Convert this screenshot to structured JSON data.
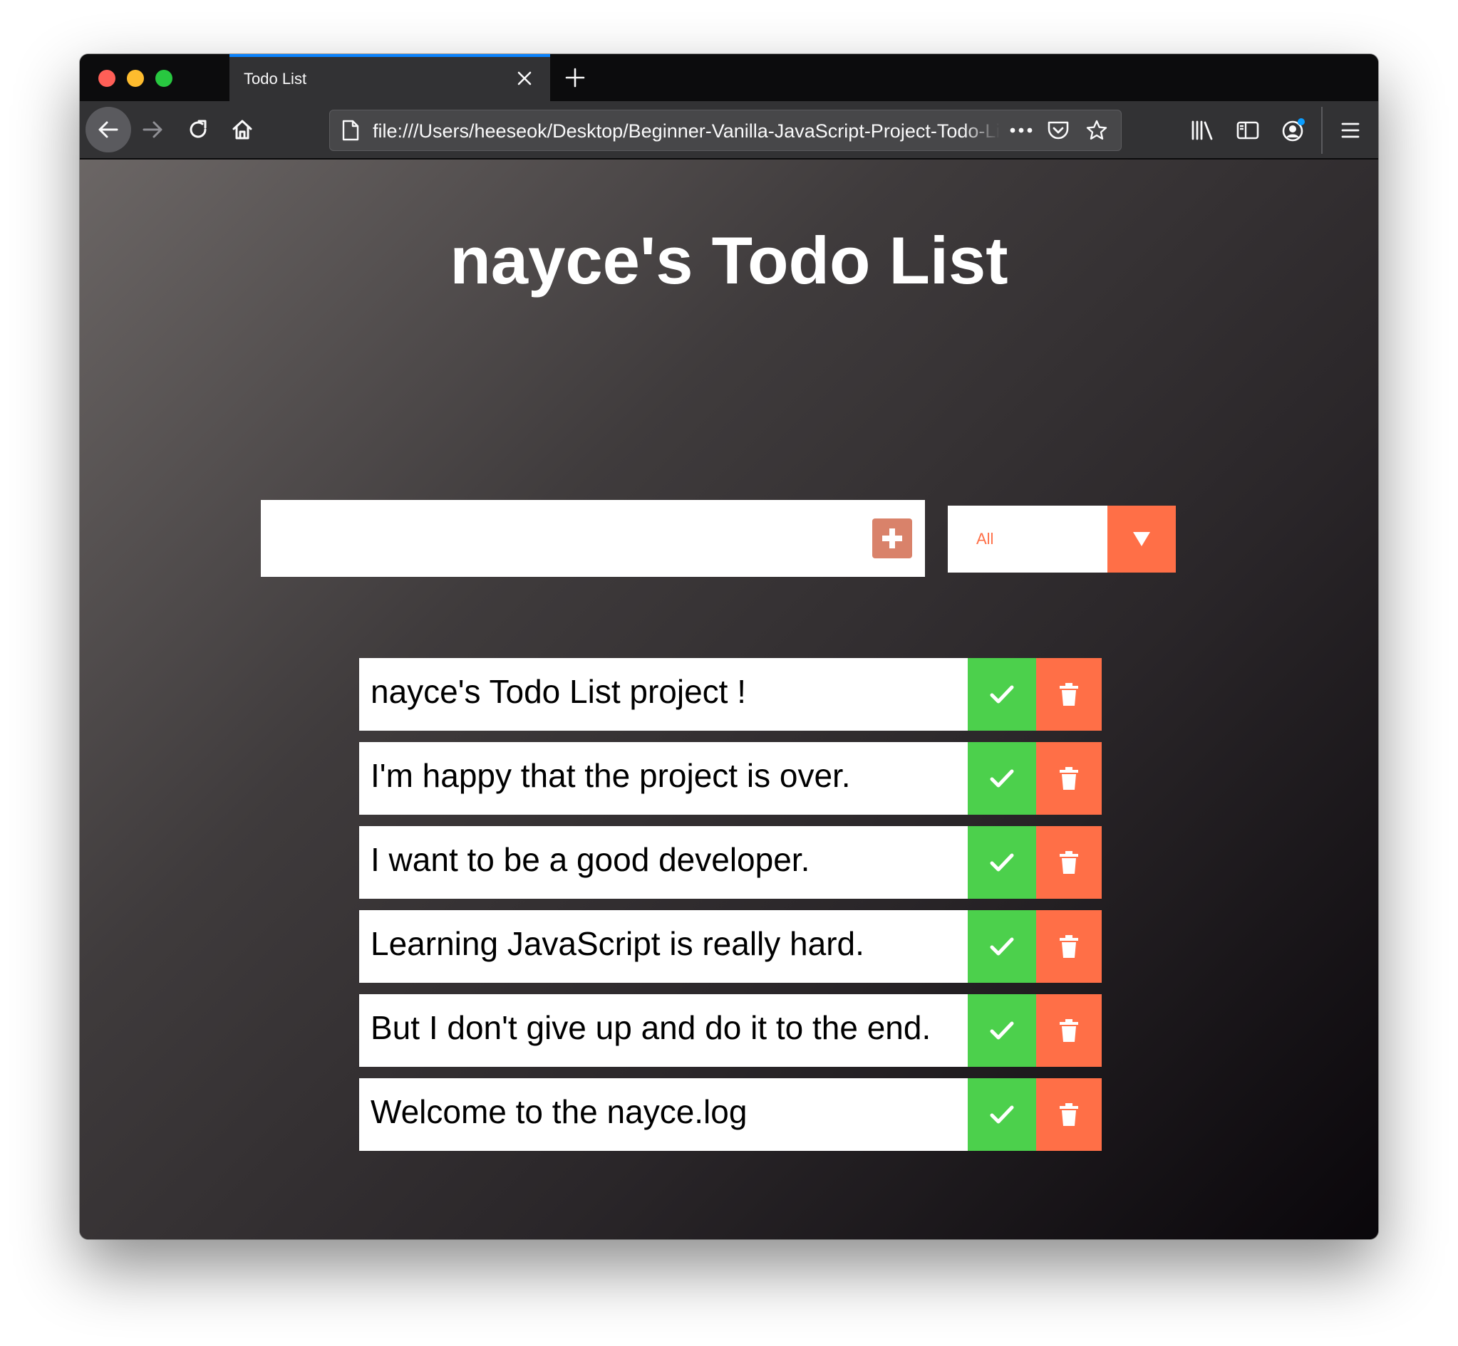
{
  "browser": {
    "tab_title": "Todo List",
    "url": "file:///Users/heeseok/Desktop/Beginner-Vanilla-JavaScript-Project-Todo-List/index.html",
    "icons": {
      "back": "arrow-left-icon",
      "forward": "arrow-right-icon",
      "reload": "reload-icon",
      "home": "home-icon",
      "page": "page-icon",
      "more": "more-dots-icon",
      "pocket": "pocket-icon",
      "bookmark": "star-icon",
      "library": "library-icon",
      "sidebar": "sidebar-icon",
      "account": "account-icon",
      "menu": "hamburger-menu-icon"
    }
  },
  "page": {
    "title": "nayce's Todo List"
  },
  "todo_input": {
    "value": "",
    "placeholder": ""
  },
  "filter": {
    "selected": "All"
  },
  "todos": [
    {
      "text": "nayce's Todo List project !"
    },
    {
      "text": "I'm happy that the project is over."
    },
    {
      "text": "I want to be a good developer."
    },
    {
      "text": "Learning JavaScript is really hard."
    },
    {
      "text": "But I don't give up and do it to the end."
    },
    {
      "text": "Welcome to the nayce.log"
    }
  ],
  "colors": {
    "check": "#4cd04c",
    "trash": "#ff6f47",
    "add": "#d9826a",
    "accent_tab": "#0a84ff"
  }
}
